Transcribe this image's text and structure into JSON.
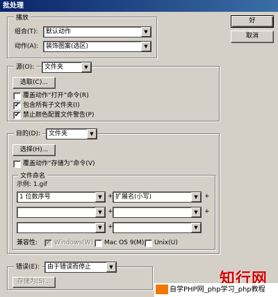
{
  "window": {
    "title": "批处理"
  },
  "buttons": {
    "ok": "好",
    "cancel": "取消"
  },
  "play": {
    "legend": "播放",
    "set_label": "组合(T):",
    "set_value": "默认动作",
    "action_label": "动作(A):",
    "action_value": "装饰图案(选区)"
  },
  "source": {
    "label": "源(O):",
    "value": "文件夹",
    "choose": "选取(C)...",
    "override_open": "覆盖动作“打开”命令(R)",
    "override_open_checked": false,
    "include_subfolders": "包含所有子文件夹(I)",
    "include_subfolders_checked": true,
    "suppress_color": "禁止颜色配置文件警告(P)",
    "suppress_color_checked": true
  },
  "destination": {
    "label": "目的(D):",
    "value": "文件夹",
    "choose": "选择(H)...",
    "override_save": "覆盖动作“存储为”命令(V)",
    "override_save_checked": false,
    "naming_legend": "文件命名",
    "example": "示例: 1.gif",
    "field1": "1 位数序号",
    "field2": "扩展名(小写)",
    "field3": "",
    "field4": "",
    "field5": "",
    "field6": "",
    "plus": "+",
    "compat_label": "兼容性:",
    "compat_windows": "Windows(W)",
    "compat_mac": "Mac OS 9(M)",
    "compat_unix": "Unix(U)",
    "check_mark": "✔"
  },
  "errors": {
    "label": "错误(E):",
    "value": "由于错误而停止",
    "save_as": "存储为(S)..."
  },
  "watermark": {
    "brand": "知行网",
    "text": "自学PHP网_php学习_php教程"
  }
}
